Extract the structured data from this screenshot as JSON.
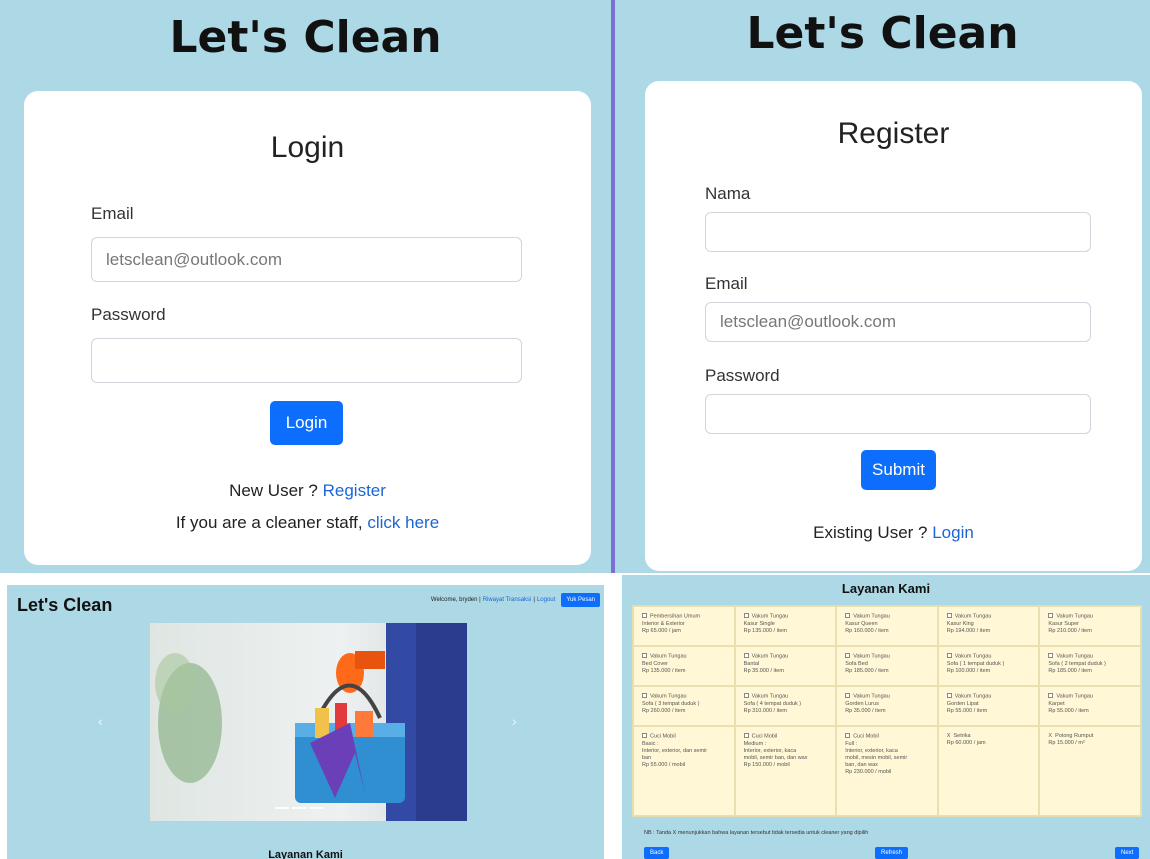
{
  "login": {
    "app_title": "Let's Clean",
    "heading": "Login",
    "email_label": "Email",
    "email_placeholder": "letsclean@outlook.com",
    "password_label": "Password",
    "button": "Login",
    "new_user_text": "New User ? ",
    "register_link": "Register",
    "staff_text": "If you are a cleaner staff, ",
    "staff_link": "click here"
  },
  "register": {
    "app_title": "Let's Clean",
    "heading": "Register",
    "name_label": "Nama",
    "email_label": "Email",
    "email_placeholder": "letsclean@outlook.com",
    "password_label": "Password",
    "button": "Submit",
    "existing_text": "Existing User ? ",
    "login_link": "Login"
  },
  "home": {
    "app_title": "Let's Clean",
    "welcome": "Welcome, bryden |",
    "history_link": "Riwayat Transaksi",
    "sep": "|",
    "logout_link": "Logout",
    "order_button": "Yuk Pesan",
    "prev": "‹",
    "next": "›",
    "section_title": "Layanan Kami"
  },
  "services": {
    "title": "Layanan Kami",
    "items": [
      {
        "mark": "checkbox",
        "lines": [
          "Pembersihan Umum",
          "Interior & Exterior",
          "Rp 65.000 / jam"
        ]
      },
      {
        "mark": "checkbox",
        "lines": [
          "Vakum Tungau",
          "Kasur Single",
          "Rp 135.000 / item"
        ]
      },
      {
        "mark": "checkbox",
        "lines": [
          "Vakum Tungau",
          "Kasur Queen",
          "Rp 160.000 / item"
        ]
      },
      {
        "mark": "checkbox",
        "lines": [
          "Vakum Tungau",
          "Kasur King",
          "Rp 194.000 / item"
        ]
      },
      {
        "mark": "checkbox",
        "lines": [
          "Vakum Tungau",
          "Kasur Super",
          "Rp 210.000 / item"
        ]
      },
      {
        "mark": "checkbox",
        "lines": [
          "Vakum Tungau",
          "Bed Cover",
          "Rp 135.000 / item"
        ]
      },
      {
        "mark": "checkbox",
        "lines": [
          "Vakum Tungau",
          "Bantal",
          "Rp 35.000 / item"
        ]
      },
      {
        "mark": "checkbox",
        "lines": [
          "Vakum Tungau",
          "Sofa Bed",
          "Rp 185.000 / item"
        ]
      },
      {
        "mark": "checkbox",
        "lines": [
          "Vakum Tungau",
          "Sofa ( 1 tempat duduk )",
          "Rp 100.000 / item"
        ]
      },
      {
        "mark": "checkbox",
        "lines": [
          "Vakum Tungau",
          "Sofa ( 2 tempat duduk )",
          "Rp 185.000 / item"
        ]
      },
      {
        "mark": "checkbox",
        "lines": [
          "Vakum Tungau",
          "Sofa ( 3 tempat duduk )",
          "Rp 260.000 / item"
        ]
      },
      {
        "mark": "checkbox",
        "lines": [
          "Vakum Tungau",
          "Sofa ( 4 tempat duduk )",
          "Rp 310.000 / item"
        ]
      },
      {
        "mark": "checkbox",
        "lines": [
          "Vakum Tungau",
          "Gorden Lurus",
          "Rp 35.000 / item"
        ]
      },
      {
        "mark": "checkbox",
        "lines": [
          "Vakum Tungau",
          "Gorden Lipat",
          "Rp 55.000 / item"
        ]
      },
      {
        "mark": "checkbox",
        "lines": [
          "Vakum Tungau",
          "Karpet",
          "Rp 55.000 / item"
        ]
      },
      {
        "mark": "checkbox",
        "lines": [
          "Cuci Mobil",
          "Basic :",
          "Interior, exterior, dan semir",
          "ban",
          "Rp 55.000 / mobil"
        ]
      },
      {
        "mark": "checkbox",
        "lines": [
          "Cuci Mobil",
          "Medium :",
          "Interior, exterior, kaca",
          "mobil, semir ban, dan wax",
          "Rp 150.000 / mobil"
        ]
      },
      {
        "mark": "checkbox",
        "lines": [
          "Cuci Mobil",
          "Full :",
          "Interior, exterior, kaca",
          "mobil, mesin mobil, semir",
          "ban, dan wax",
          "Rp 230.000 / mobil"
        ]
      },
      {
        "mark": "x",
        "lines": [
          "Setrika",
          "Rp 60.000 / jam"
        ]
      },
      {
        "mark": "x",
        "lines": [
          "Potong Rumput",
          "Rp 15.000 / m²"
        ]
      }
    ],
    "note": "NB : Tanda X menunjukkan bahwa layanan tersebut tidak tersedia untuk cleaner yang dipilih",
    "back": "Back",
    "refresh": "Refresh",
    "next": "Next"
  }
}
